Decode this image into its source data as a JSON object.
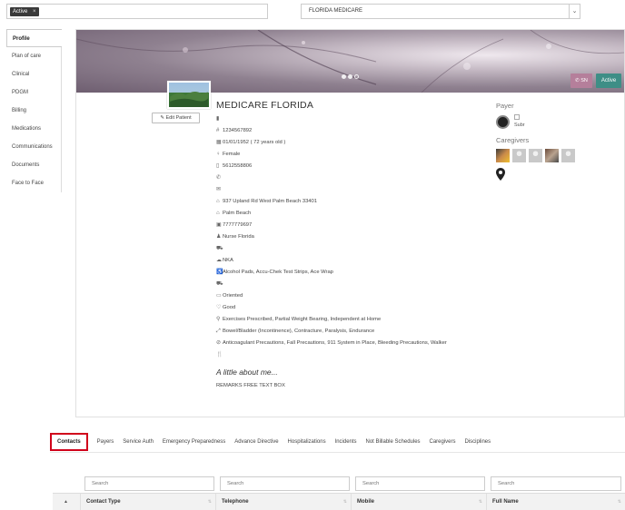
{
  "filter": {
    "tag_label": "Active",
    "remove_glyph": "×"
  },
  "payer_select": {
    "value": "FLORIDA MEDICARE",
    "caret_glyph": "⌄"
  },
  "sidebar": {
    "items": [
      {
        "label": "Profile",
        "active": true
      },
      {
        "label": "Plan of care"
      },
      {
        "label": "Clinical"
      },
      {
        "label": "PDGM"
      },
      {
        "label": "Billing"
      },
      {
        "label": "Medications"
      },
      {
        "label": "Communications"
      },
      {
        "label": "Documents"
      },
      {
        "label": "Face to Face"
      }
    ]
  },
  "banner": {
    "sn_label": "SN",
    "status_label": "Active"
  },
  "patient": {
    "name": "MEDICARE FLORIDA",
    "edit_label": "Edit Patient",
    "details": [
      {
        "icon": "bookmark-icon",
        "glyph": "▮",
        "text": ""
      },
      {
        "icon": "hash-icon",
        "glyph": "#",
        "text": "1234567892"
      },
      {
        "icon": "calendar-icon",
        "glyph": "▦",
        "text": "01/01/1952 ( 72 years old )"
      },
      {
        "icon": "gender-icon",
        "glyph": "♀",
        "text": "Female"
      },
      {
        "icon": "mobile-icon",
        "glyph": "▯",
        "text": "5612558806"
      },
      {
        "icon": "phone-icon",
        "glyph": "✆",
        "text": ""
      },
      {
        "icon": "envelope-icon",
        "glyph": "✉",
        "text": ""
      },
      {
        "icon": "home-icon",
        "glyph": "⌂",
        "text": "937 Upland Rd West Palm Beach 33401"
      },
      {
        "icon": "county-icon",
        "glyph": "⌂",
        "text": "Palm Beach"
      },
      {
        "icon": "id-card-icon",
        "glyph": "▣",
        "text": "7777779697"
      },
      {
        "icon": "user-icon",
        "glyph": "♟",
        "text": "Nurse Florida"
      },
      {
        "icon": "cart-icon",
        "glyph": "⛟",
        "text": ""
      },
      {
        "icon": "allergy-icon",
        "glyph": "☁",
        "text": "NKA"
      },
      {
        "icon": "wheelchair-icon",
        "glyph": "♿",
        "text": "Alcohol Pads, Accu-Chek Test Strips, Ace Wrap"
      },
      {
        "icon": "cart-icon",
        "glyph": "⛟",
        "text": ""
      },
      {
        "icon": "mental-icon",
        "glyph": "▭",
        "text": "Oriented"
      },
      {
        "icon": "prognosis-icon",
        "glyph": "♡",
        "text": "Good"
      },
      {
        "icon": "activity-icon",
        "glyph": "⚲",
        "text": "Exercises Prescribed, Partial Weight Bearing, Independent at Home"
      },
      {
        "icon": "functional-icon",
        "glyph": "⤢",
        "text": "Bowel/Bladder (Incontinence), Contracture, Paralysis, Endurance"
      },
      {
        "icon": "safety-icon",
        "glyph": "⊘",
        "text": "Anticoagulant Precautions, Fall Precautions, 911 System in Place, Bleeding Precautions, Walker"
      },
      {
        "icon": "nutrition-icon",
        "glyph": "🍴",
        "text": ""
      }
    ],
    "about_title": "A little about me...",
    "about_text": "REMARKS FREE TEXT BOX"
  },
  "right_panel": {
    "payer_label": "Payer",
    "payer_image_alt": "Subr",
    "caregivers_label": "Caregivers",
    "caregivers": [
      {
        "avatar": "photo1"
      },
      {
        "avatar": "gray"
      },
      {
        "avatar": "gray"
      },
      {
        "avatar": "photo2"
      },
      {
        "avatar": "gray"
      }
    ]
  },
  "tabs": [
    {
      "label": "Contacts",
      "active": true
    },
    {
      "label": "Payers"
    },
    {
      "label": "Service Auth"
    },
    {
      "label": "Emergency Preparedness"
    },
    {
      "label": "Advance Directive"
    },
    {
      "label": "Hospitalizations"
    },
    {
      "label": "Incidents"
    },
    {
      "label": "Not Billable Schedules"
    },
    {
      "label": "Caregivers"
    },
    {
      "label": "Disciplines"
    }
  ],
  "table": {
    "search_placeholder": "Search",
    "columns": [
      "Contact Type",
      "Telephone",
      "Mobile",
      "Full Name"
    ],
    "sort_glyph": "▲",
    "sortable_glyph": "⇅"
  },
  "colors": {
    "sn_button": "#b57f9b",
    "active_button": "#3e8e86",
    "highlight_border": "#d0021b"
  }
}
